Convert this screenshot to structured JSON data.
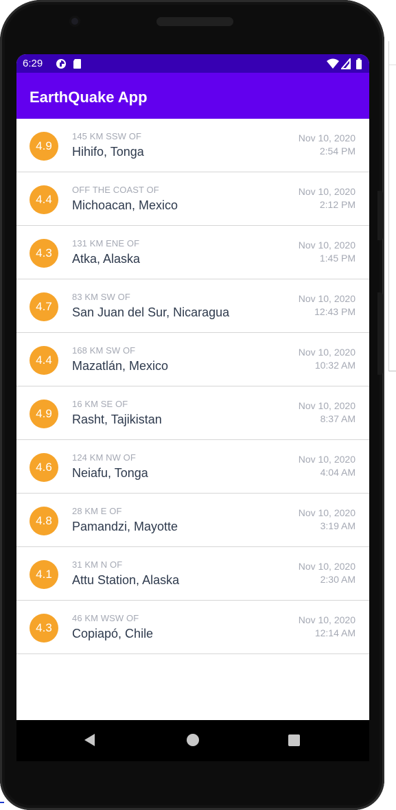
{
  "status_bar": {
    "time": "6:29"
  },
  "app_bar": {
    "title": "EarthQuake App"
  },
  "colors": {
    "status_bar": "#3700b3",
    "app_bar": "#6200ee",
    "magnitude_badge": "#f6a42a"
  },
  "quakes": [
    {
      "mag": "4.9",
      "offset": "145 KM SSW OF",
      "location": "Hihifo, Tonga",
      "date": "Nov 10, 2020",
      "time": "2:54 PM"
    },
    {
      "mag": "4.4",
      "offset": "OFF THE COAST OF",
      "location": "Michoacan, Mexico",
      "date": "Nov 10, 2020",
      "time": "2:12 PM"
    },
    {
      "mag": "4.3",
      "offset": "131 KM ENE OF",
      "location": "Atka, Alaska",
      "date": "Nov 10, 2020",
      "time": "1:45 PM"
    },
    {
      "mag": "4.7",
      "offset": "83 KM SW OF",
      "location": "San Juan del Sur, Nicaragua",
      "date": "Nov 10, 2020",
      "time": "12:43 PM"
    },
    {
      "mag": "4.4",
      "offset": "168 KM SW OF",
      "location": "Mazatlán, Mexico",
      "date": "Nov 10, 2020",
      "time": "10:32 AM"
    },
    {
      "mag": "4.9",
      "offset": "16 KM SE OF",
      "location": "Rasht, Tajikistan",
      "date": "Nov 10, 2020",
      "time": "8:37 AM"
    },
    {
      "mag": "4.6",
      "offset": "124 KM NW OF",
      "location": "Neiafu, Tonga",
      "date": "Nov 10, 2020",
      "time": "4:04 AM"
    },
    {
      "mag": "4.8",
      "offset": "28 KM E OF",
      "location": "Pamandzi, Mayotte",
      "date": "Nov 10, 2020",
      "time": "3:19 AM"
    },
    {
      "mag": "4.1",
      "offset": "31 KM N OF",
      "location": "Attu Station, Alaska",
      "date": "Nov 10, 2020",
      "time": "2:30 AM"
    },
    {
      "mag": "4.3",
      "offset": "46 KM WSW OF",
      "location": "Copiapó, Chile",
      "date": "Nov 10, 2020",
      "time": "12:14 AM"
    }
  ],
  "nav_bar": {
    "icons": [
      "back-icon",
      "home-icon",
      "recents-icon"
    ]
  }
}
